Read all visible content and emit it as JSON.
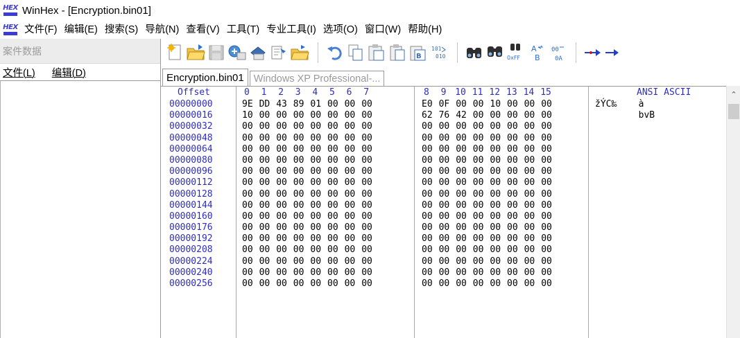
{
  "window": {
    "title": "WinHex - [Encryption.bin01]"
  },
  "menu": [
    "文件(F)",
    "编辑(E)",
    "搜索(S)",
    "导航(N)",
    "查看(V)",
    "工具(T)",
    "专业工具(I)",
    "选项(O)",
    "窗口(W)",
    "帮助(H)"
  ],
  "case_panel": {
    "header": "案件数据",
    "menu_file": "文件(L)",
    "menu_edit": "编辑(D)"
  },
  "tabs": [
    {
      "label": "Encryption.bin01",
      "active": true
    },
    {
      "label": "Windows XP Professional-...",
      "active": false
    }
  ],
  "hex": {
    "offset_label": "Offset",
    "ansi_label": "ANSI ASCII",
    "columns": [
      "0",
      "1",
      "2",
      "3",
      "4",
      "5",
      "6",
      "7",
      "8",
      "9",
      "10",
      "11",
      "12",
      "13",
      "14",
      "15"
    ],
    "rows": [
      {
        "offset": "00000000",
        "bytes": [
          "9E",
          "DD",
          "43",
          "89",
          "01",
          "00",
          "00",
          "00",
          "E0",
          "0F",
          "00",
          "00",
          "10",
          "00",
          "00",
          "00"
        ],
        "ascii": "žÝC‰    à"
      },
      {
        "offset": "00000016",
        "bytes": [
          "10",
          "00",
          "00",
          "00",
          "00",
          "00",
          "00",
          "00",
          "62",
          "76",
          "42",
          "00",
          "00",
          "00",
          "00",
          "00"
        ],
        "ascii": "        bvB"
      },
      {
        "offset": "00000032",
        "bytes": [
          "00",
          "00",
          "00",
          "00",
          "00",
          "00",
          "00",
          "00",
          "00",
          "00",
          "00",
          "00",
          "00",
          "00",
          "00",
          "00"
        ],
        "ascii": ""
      },
      {
        "offset": "00000048",
        "bytes": [
          "00",
          "00",
          "00",
          "00",
          "00",
          "00",
          "00",
          "00",
          "00",
          "00",
          "00",
          "00",
          "00",
          "00",
          "00",
          "00"
        ],
        "ascii": ""
      },
      {
        "offset": "00000064",
        "bytes": [
          "00",
          "00",
          "00",
          "00",
          "00",
          "00",
          "00",
          "00",
          "00",
          "00",
          "00",
          "00",
          "00",
          "00",
          "00",
          "00"
        ],
        "ascii": ""
      },
      {
        "offset": "00000080",
        "bytes": [
          "00",
          "00",
          "00",
          "00",
          "00",
          "00",
          "00",
          "00",
          "00",
          "00",
          "00",
          "00",
          "00",
          "00",
          "00",
          "00"
        ],
        "ascii": ""
      },
      {
        "offset": "00000096",
        "bytes": [
          "00",
          "00",
          "00",
          "00",
          "00",
          "00",
          "00",
          "00",
          "00",
          "00",
          "00",
          "00",
          "00",
          "00",
          "00",
          "00"
        ],
        "ascii": ""
      },
      {
        "offset": "00000112",
        "bytes": [
          "00",
          "00",
          "00",
          "00",
          "00",
          "00",
          "00",
          "00",
          "00",
          "00",
          "00",
          "00",
          "00",
          "00",
          "00",
          "00"
        ],
        "ascii": ""
      },
      {
        "offset": "00000128",
        "bytes": [
          "00",
          "00",
          "00",
          "00",
          "00",
          "00",
          "00",
          "00",
          "00",
          "00",
          "00",
          "00",
          "00",
          "00",
          "00",
          "00"
        ],
        "ascii": ""
      },
      {
        "offset": "00000144",
        "bytes": [
          "00",
          "00",
          "00",
          "00",
          "00",
          "00",
          "00",
          "00",
          "00",
          "00",
          "00",
          "00",
          "00",
          "00",
          "00",
          "00"
        ],
        "ascii": ""
      },
      {
        "offset": "00000160",
        "bytes": [
          "00",
          "00",
          "00",
          "00",
          "00",
          "00",
          "00",
          "00",
          "00",
          "00",
          "00",
          "00",
          "00",
          "00",
          "00",
          "00"
        ],
        "ascii": ""
      },
      {
        "offset": "00000176",
        "bytes": [
          "00",
          "00",
          "00",
          "00",
          "00",
          "00",
          "00",
          "00",
          "00",
          "00",
          "00",
          "00",
          "00",
          "00",
          "00",
          "00"
        ],
        "ascii": ""
      },
      {
        "offset": "00000192",
        "bytes": [
          "00",
          "00",
          "00",
          "00",
          "00",
          "00",
          "00",
          "00",
          "00",
          "00",
          "00",
          "00",
          "00",
          "00",
          "00",
          "00"
        ],
        "ascii": ""
      },
      {
        "offset": "00000208",
        "bytes": [
          "00",
          "00",
          "00",
          "00",
          "00",
          "00",
          "00",
          "00",
          "00",
          "00",
          "00",
          "00",
          "00",
          "00",
          "00",
          "00"
        ],
        "ascii": ""
      },
      {
        "offset": "00000224",
        "bytes": [
          "00",
          "00",
          "00",
          "00",
          "00",
          "00",
          "00",
          "00",
          "00",
          "00",
          "00",
          "00",
          "00",
          "00",
          "00",
          "00"
        ],
        "ascii": ""
      },
      {
        "offset": "00000240",
        "bytes": [
          "00",
          "00",
          "00",
          "00",
          "00",
          "00",
          "00",
          "00",
          "00",
          "00",
          "00",
          "00",
          "00",
          "00",
          "00",
          "00"
        ],
        "ascii": ""
      },
      {
        "offset": "00000256",
        "bytes": [
          "00",
          "00",
          "00",
          "00",
          "00",
          "00",
          "00",
          "00",
          "00",
          "00",
          "00",
          "00",
          "00",
          "00",
          "00",
          "00"
        ],
        "ascii": ""
      }
    ]
  },
  "toolbar_icons": [
    "new-file-icon",
    "open-folder-icon",
    "save-icon",
    "save-all-icon",
    "print-icon",
    "properties-icon",
    "open-folder-alt-icon",
    "undo-icon",
    "copy-icon",
    "cut-icon",
    "paste-icon",
    "paste-hex-icon",
    "convert-binary-icon",
    "find-text-icon",
    "find-hex-icon",
    "find-replace-hex-icon",
    "replace-text-icon",
    "replace-hex-icon",
    "goto-offset-icon",
    "goto-next-icon"
  ],
  "colors": {
    "offset_blue": "#2d2dc0",
    "separator": "#a8a8a8",
    "logo_blue": "#3b3bd8"
  }
}
